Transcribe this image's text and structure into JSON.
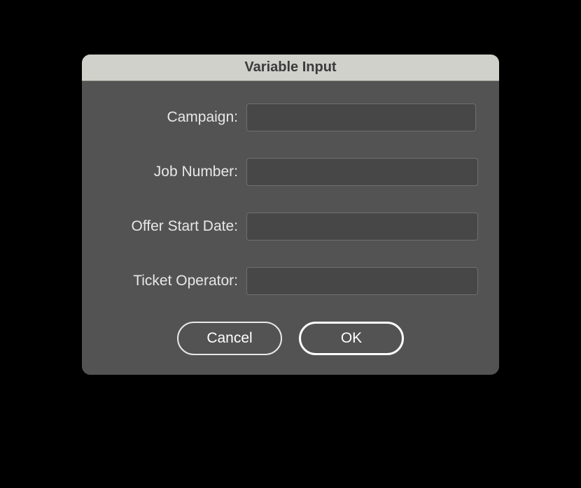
{
  "dialog": {
    "title": "Variable Input",
    "fields": {
      "campaign": {
        "label": "Campaign:",
        "value": ""
      },
      "job_number": {
        "label": "Job Number:",
        "value": ""
      },
      "offer_start_date": {
        "label": "Offer Start Date:",
        "value": ""
      },
      "ticket_operator": {
        "label": "Ticket Operator:",
        "value": ""
      }
    },
    "buttons": {
      "cancel": "Cancel",
      "ok": "OK"
    }
  }
}
